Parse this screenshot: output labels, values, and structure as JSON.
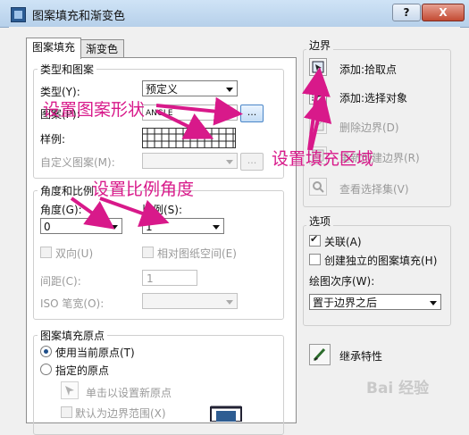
{
  "window": {
    "title": "图案填充和渐变色",
    "help_label": "?",
    "close_label": "X"
  },
  "tabs": [
    {
      "label": "图案填充",
      "active": true
    },
    {
      "label": "渐变色",
      "active": false
    }
  ],
  "type_pattern": {
    "group_label": "类型和图案",
    "type_label": "类型(Y):",
    "type_value": "预定义",
    "pattern_label": "图案(P):",
    "pattern_value": "ANGLE",
    "browse_label": "...",
    "swatch_label": "样例:",
    "custom_label": "自定义图案(M):",
    "custom_browse_label": "..."
  },
  "angle_scale": {
    "group_label": "角度和比例",
    "angle_label": "角度(G):",
    "angle_value": "0",
    "scale_label": "比例(S):",
    "scale_value": "1",
    "double_label": "双向(U)",
    "relative_label": "相对图纸空间(E)",
    "spacing_label": "间距(C):",
    "spacing_value": "1",
    "iso_label": "ISO 笔宽(O):",
    "iso_value": ""
  },
  "origin": {
    "group_label": "图案填充原点",
    "use_current_label": "使用当前原点(T)",
    "specified_label": "指定的原点",
    "click_set_label": "单击以设置新原点",
    "default_extent_label": "默认为边界范围(X)"
  },
  "boundary": {
    "group_label": "边界",
    "add_pick_label": "添加:拾取点",
    "add_select_label": "添加:选择对象",
    "remove_label": "删除边界(D)",
    "recreate_label": "重新创建边界(R)",
    "view_label": "查看选择集(V)"
  },
  "options": {
    "group_label": "选项",
    "associative_label": "关联(A)",
    "associative_checked": true,
    "separate_label": "创建独立的图案填充(H)",
    "separate_checked": false,
    "draw_order_label": "绘图次序(W):",
    "draw_order_value": "置于边界之后"
  },
  "inherit": {
    "label": "继承特性"
  },
  "annotations": {
    "pattern_shape": "设置图案形状",
    "scale_angle": "设置比例角度",
    "fill_area": "设置填充区域"
  },
  "watermark": "Bai 经验",
  "colors": {
    "annotation": "#d8198a",
    "accent": "#4a86c8"
  }
}
